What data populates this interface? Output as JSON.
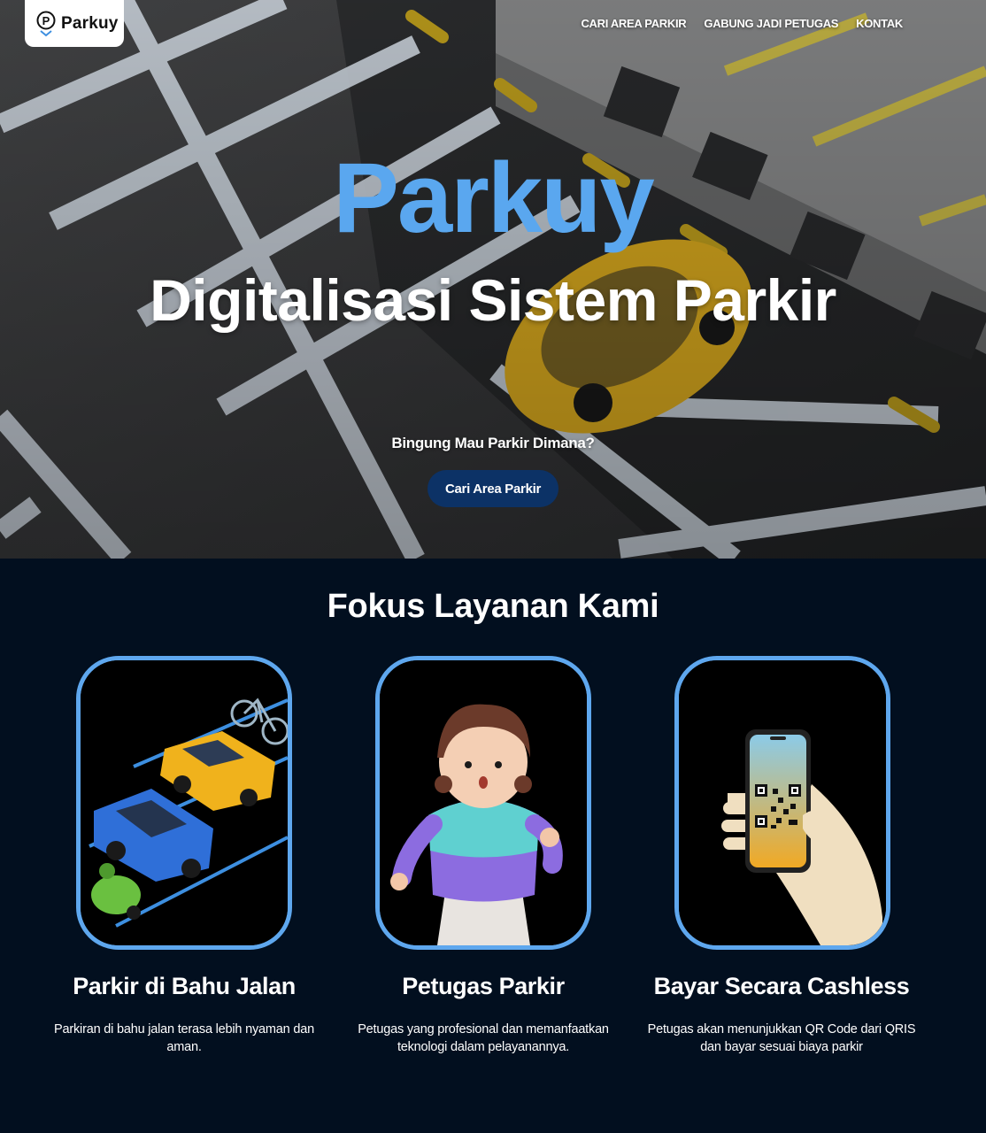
{
  "brand": {
    "name": "Parkuy"
  },
  "nav": {
    "items": [
      "CARI AREA PARKIR",
      "GABUNG JADI PETUGAS",
      "KONTAK"
    ]
  },
  "hero": {
    "title": "Parkuy",
    "subtitle": "Digitalisasi Sistem Parkir",
    "question": "Bingung Mau Parkir Dimana?",
    "cta_label": "Cari Area Parkir"
  },
  "services": {
    "heading": "Fokus Layanan Kami",
    "cards": [
      {
        "title": "Parkir di Bahu Jalan",
        "desc": "Parkiran di bahu jalan terasa lebih nyaman dan aman."
      },
      {
        "title": "Petugas Parkir",
        "desc": "Petugas yang profesional dan memanfaatkan teknologi dalam pelayanannya."
      },
      {
        "title": "Bayar Secara Cashless",
        "desc": "Petugas akan menunjukkan QR Code dari QRIS dan bayar sesuai biaya parkir"
      }
    ]
  },
  "colors": {
    "accent": "#5aa7ef",
    "button": "#0c3266",
    "background": "#020f1f"
  }
}
